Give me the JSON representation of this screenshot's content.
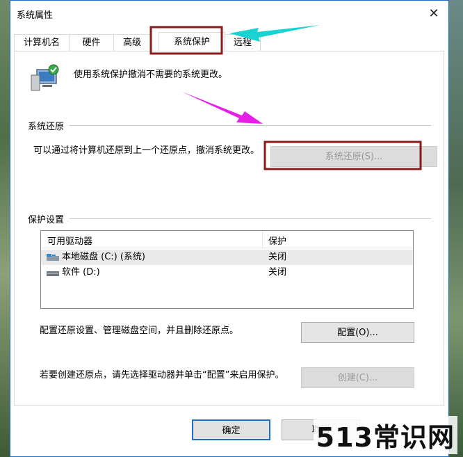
{
  "window": {
    "title": "系统属性",
    "close_glyph": "✕"
  },
  "tabs": [
    {
      "label": "计算机名"
    },
    {
      "label": "硬件"
    },
    {
      "label": "高级"
    },
    {
      "label": "系统保护"
    },
    {
      "label": "远程"
    }
  ],
  "header": {
    "description": "使用系统保护撤消不需要的系统更改。"
  },
  "restore": {
    "section_title": "系统还原",
    "description": "可以通过将计算机还原到上一个还原点，撤消系统更改。",
    "button_label": "系统还原(S)..."
  },
  "protection": {
    "section_title": "保护设置",
    "columns": [
      "可用驱动器",
      "保护"
    ],
    "drives": [
      {
        "name": "本地磁盘 (C:) (系统)",
        "status": "关闭",
        "icon": "system-drive-icon"
      },
      {
        "name": "软件 (D:)",
        "status": "关闭",
        "icon": "drive-icon"
      }
    ],
    "configure_text": "配置还原设置、管理磁盘空间，并且删除还原点。",
    "configure_button": "配置(O)...",
    "create_text": "若要创建还原点，请先选择驱动器并单击“配置”来启用保护。",
    "create_button": "创建(C)..."
  },
  "footer": {
    "ok_label": "确定",
    "cancel_label": "取消"
  },
  "watermark": "513常识网",
  "colors": {
    "accent": "#1e6fc0",
    "highlight_box": "#8b1a1a",
    "arrow_cyan": "#19d2d2",
    "arrow_magenta": "#e61ee6"
  }
}
